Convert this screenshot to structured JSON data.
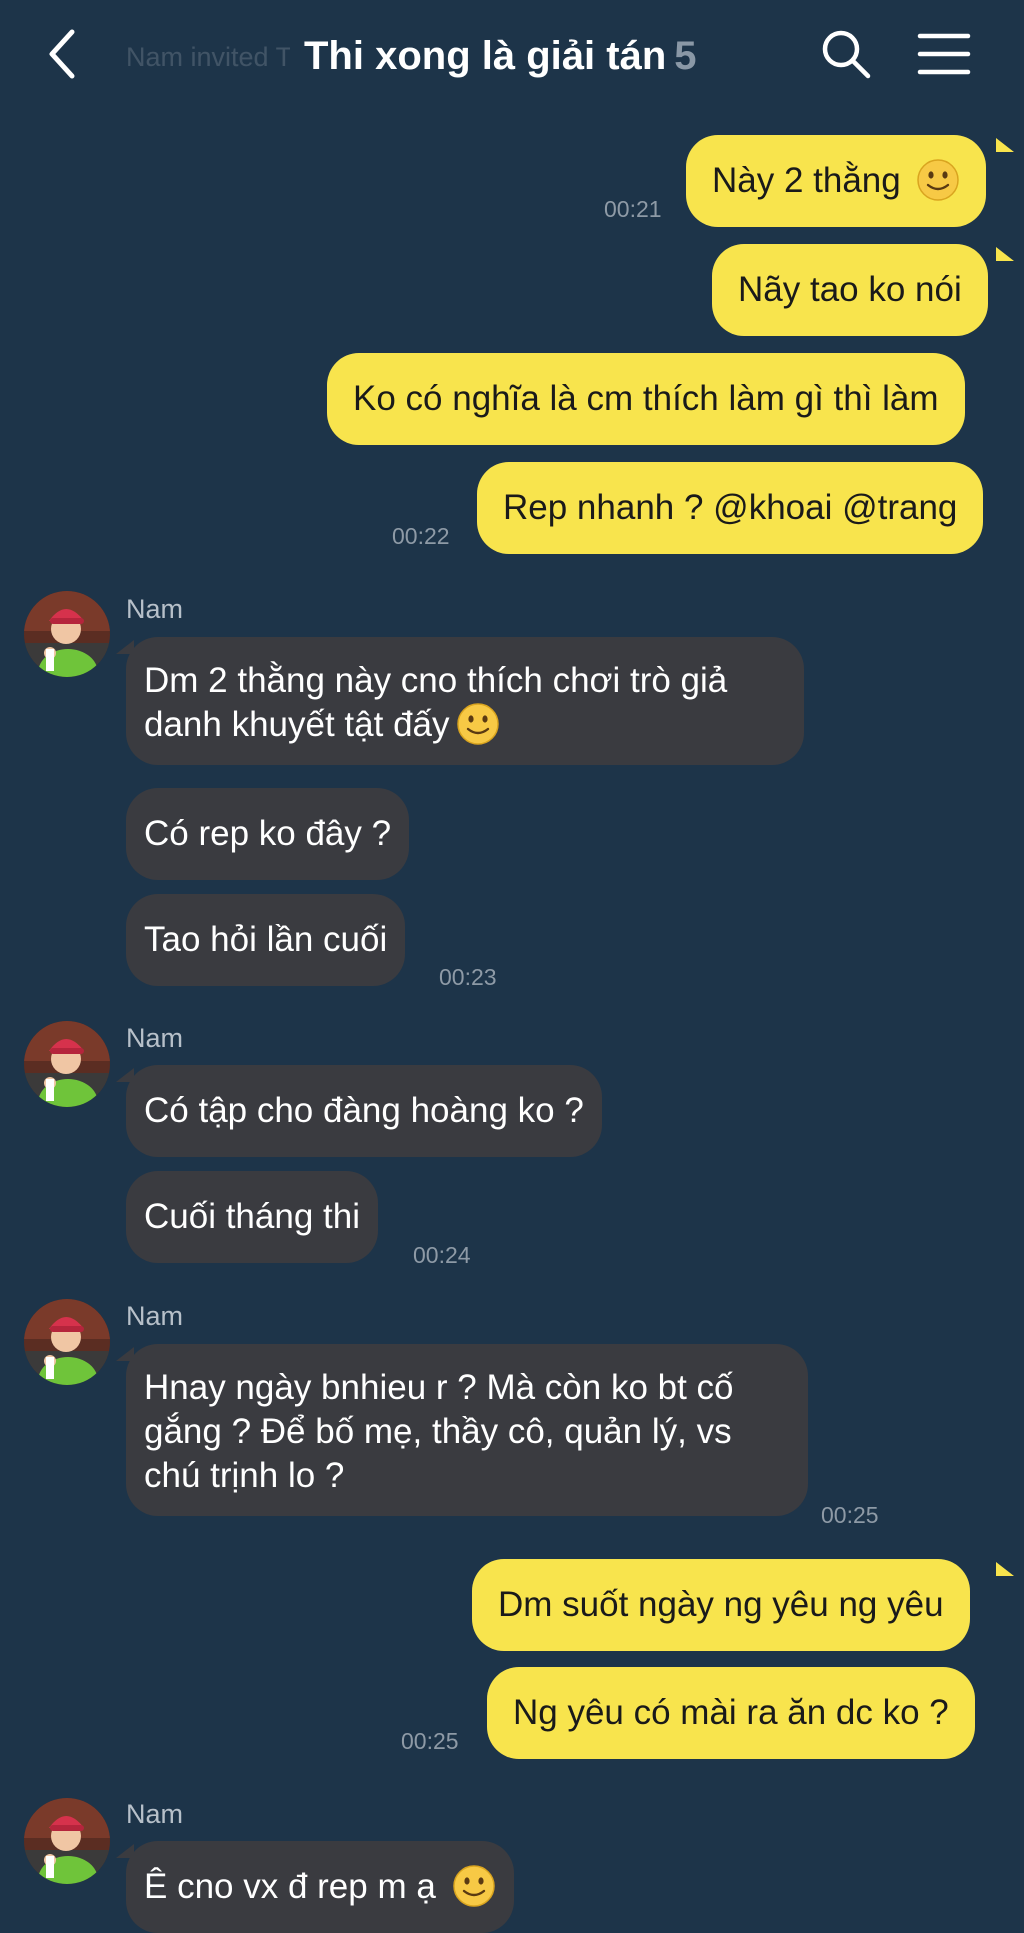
{
  "header": {
    "title": "Thi xong là giải tán",
    "member_count": "5",
    "subtitle": "Nam invited Trang, Khoai, Trang, Minh..."
  },
  "messages": [
    {
      "text": "Này 2 thằng",
      "emoji": "slightly-smiling-face"
    },
    {
      "text": "Nãy tao ko nói"
    },
    {
      "text": "Ko có nghĩa là cm thích làm gì thì làm"
    },
    {
      "text": "Rep nhanh ? @khoai @trang"
    },
    {
      "text": "Dm 2 thằng này cno thích chơi trò giả danh khuyết tật đấy",
      "emoji": "slightly-smiling-face"
    },
    {
      "text": "Có rep ko đây ?"
    },
    {
      "text": "Tao hỏi lần cuối"
    },
    {
      "text": "Có tập cho đàng hoàng ko ?"
    },
    {
      "text": "Cuối tháng thi"
    },
    {
      "text": "Hnay ngày bnhieu r ? Mà còn ko bt cố gắng ? Để bố mẹ, thầy cô, quản lý, vs chú trịnh lo ?"
    },
    {
      "text": "Dm suốt ngày ng yêu ng yêu"
    },
    {
      "text": "Ng yêu có mài ra ăn dc ko ?"
    },
    {
      "text": "Ê cno vx đ rep m ạ",
      "emoji": "slightly-smiling-face"
    }
  ],
  "times": [
    "00:21",
    "00:22",
    "00:23",
    "00:24",
    "00:25",
    "00:25"
  ],
  "sender_name": "Nam",
  "colors": {
    "background": "#1d3449",
    "outgoing_bubble": "#f8e44d",
    "incoming_bubble": "#3a3b40",
    "timestamp": "#8e9aa6"
  },
  "icons": [
    "back-arrow-icon",
    "search-icon",
    "menu-icon",
    "avatar",
    "slightly-smiling-face-emoji"
  ]
}
